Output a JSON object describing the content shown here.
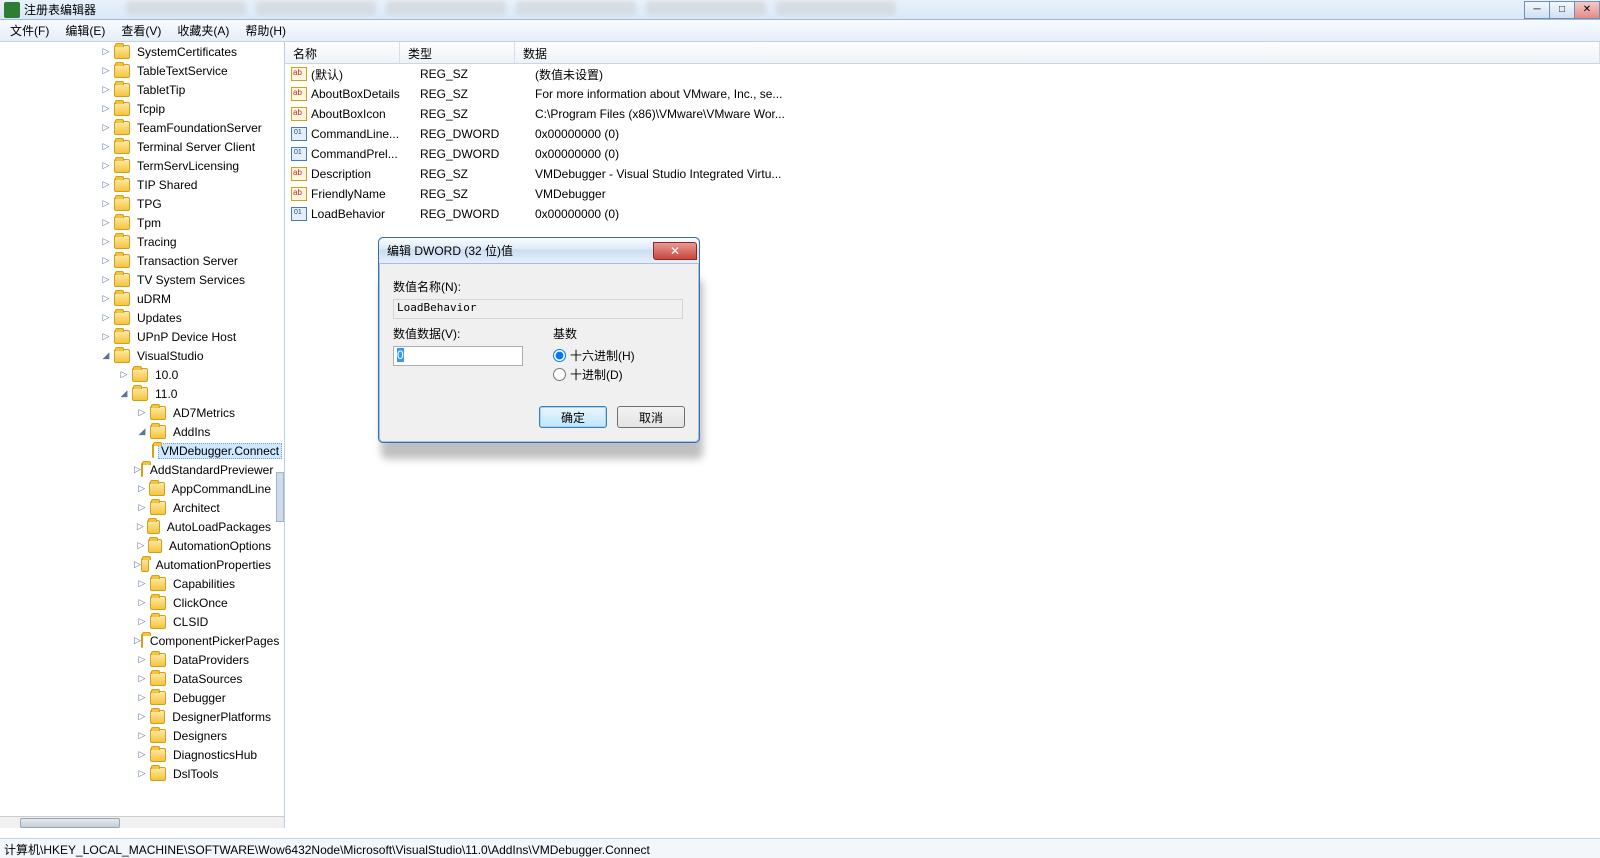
{
  "app": {
    "title": "注册表编辑器"
  },
  "menu": {
    "file": "文件(F)",
    "edit": "编辑(E)",
    "view": "查看(V)",
    "fav": "收藏夹(A)",
    "help": "帮助(H)"
  },
  "tree": {
    "top": [
      "SystemCertificates",
      "TableTextService",
      "TabletTip",
      "Tcpip",
      "TeamFoundationServer",
      "Terminal Server Client",
      "TermServLicensing",
      "TIP Shared",
      "TPG",
      "Tpm",
      "Tracing",
      "Transaction Server",
      "TV System Services",
      "uDRM",
      "Updates",
      "UPnP Device Host"
    ],
    "vs": "VisualStudio",
    "vs_children": [
      "10.0"
    ],
    "vs11": "11.0",
    "vs11_children_before": [
      "AD7Metrics"
    ],
    "addins": "AddIns",
    "vmdebugger": "VMDebugger.Connect",
    "vs11_children_after": [
      "AddStandardPreviewer",
      "AppCommandLine",
      "Architect",
      "AutoLoadPackages",
      "AutomationOptions",
      "AutomationProperties",
      "Capabilities",
      "ClickOnce",
      "CLSID",
      "ComponentPickerPages",
      "DataProviders",
      "DataSources",
      "Debugger",
      "DesignerPlatforms",
      "Designers",
      "DiagnosticsHub",
      "DslTools"
    ]
  },
  "columns": {
    "name": "名称",
    "type": "类型",
    "data": "数据"
  },
  "rows": [
    {
      "icon": "sz",
      "name": "(默认)",
      "type": "REG_SZ",
      "data": "(数值未设置)"
    },
    {
      "icon": "sz",
      "name": "AboutBoxDetails",
      "type": "REG_SZ",
      "data": "For more information about VMware, Inc., se..."
    },
    {
      "icon": "sz",
      "name": "AboutBoxIcon",
      "type": "REG_SZ",
      "data": "C:\\Program Files (x86)\\VMware\\VMware Wor..."
    },
    {
      "icon": "dw",
      "name": "CommandLine...",
      "type": "REG_DWORD",
      "data": "0x00000000 (0)"
    },
    {
      "icon": "dw",
      "name": "CommandPrel...",
      "type": "REG_DWORD",
      "data": "0x00000000 (0)"
    },
    {
      "icon": "sz",
      "name": "Description",
      "type": "REG_SZ",
      "data": "VMDebugger - Visual Studio Integrated Virtu..."
    },
    {
      "icon": "sz",
      "name": "FriendlyName",
      "type": "REG_SZ",
      "data": "VMDebugger"
    },
    {
      "icon": "dw",
      "name": "LoadBehavior",
      "type": "REG_DWORD",
      "data": "0x00000000 (0)"
    }
  ],
  "status": "计算机\\HKEY_LOCAL_MACHINE\\SOFTWARE\\Wow6432Node\\Microsoft\\VisualStudio\\11.0\\AddIns\\VMDebugger.Connect",
  "dialog": {
    "title": "编辑 DWORD (32 位)值",
    "nameLabel": "数值名称(N):",
    "nameValue": "LoadBehavior",
    "dataLabel": "数值数据(V):",
    "dataValue": "0",
    "baseLabel": "基数",
    "hex": "十六进制(H)",
    "dec": "十进制(D)",
    "ok": "确定",
    "cancel": "取消"
  }
}
